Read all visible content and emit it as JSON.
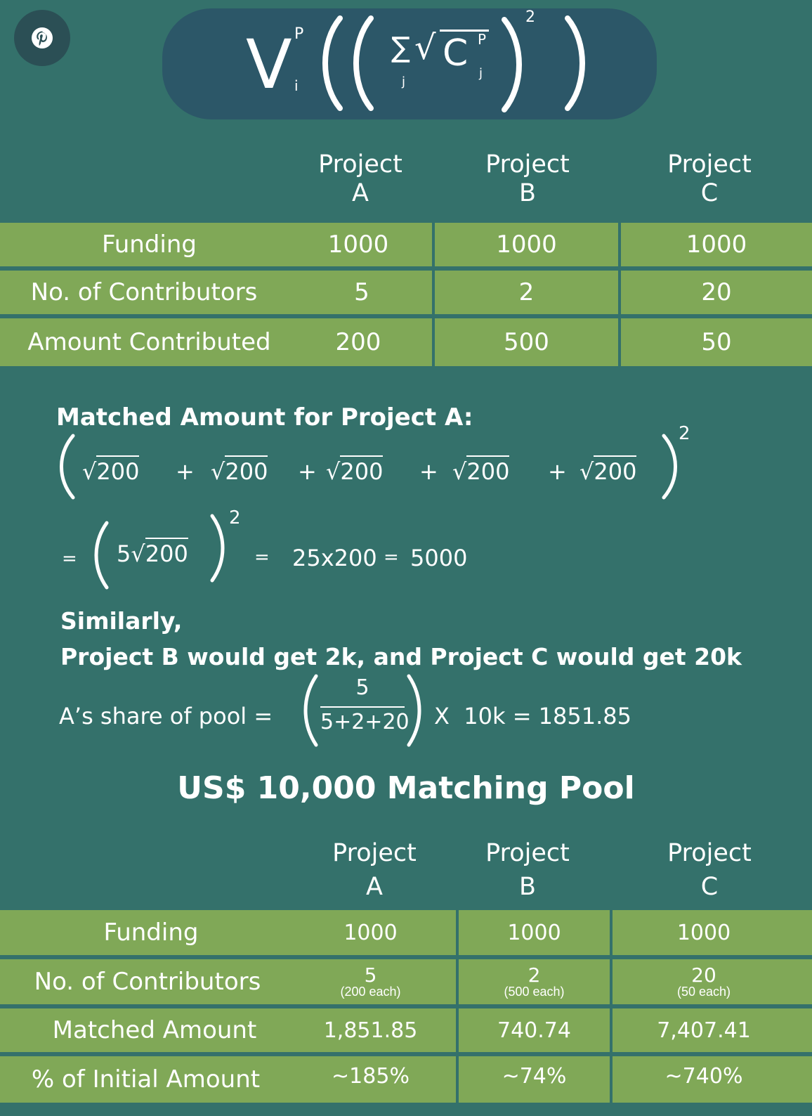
{
  "pin_icon": "pinterest-icon",
  "formula": {
    "v": "V",
    "sup_p": "P",
    "sub_i": "i",
    "sigma": "∑",
    "sub_j": "j",
    "sqrt": "√",
    "c": "C",
    "c_sup": "P",
    "c_sub": "j",
    "exp": "2"
  },
  "table1": {
    "headers": [
      {
        "line1": "Project",
        "line2": "A"
      },
      {
        "line1": "Project",
        "line2": "B"
      },
      {
        "line1": "Project",
        "line2": "C"
      }
    ],
    "rows": [
      {
        "label": "Funding",
        "values": [
          "1000",
          "1000",
          "1000"
        ]
      },
      {
        "label": "No. of Contributors",
        "values": [
          "5",
          "2",
          "20"
        ]
      },
      {
        "label": "Amount Contributed",
        "values": [
          "200",
          "500",
          "50"
        ]
      }
    ]
  },
  "math": {
    "heading": "Matched Amount for Project A:",
    "term": "200",
    "plus": "+",
    "exp": "2",
    "eq": "=",
    "five": "5",
    "calc": "25x200",
    "result": "5000",
    "similarly": "Similarly,",
    "summary": "Project B would get 2k, and Project C would get 20k",
    "share_label": "A’s share of pool =",
    "numerator": "5",
    "denominator": "5+2+20",
    "times": "X  10k = 1851.85"
  },
  "pool_title": "US$ 10,000 Matching Pool",
  "table2": {
    "headers": [
      {
        "line1": "Project",
        "line2": "A"
      },
      {
        "line1": "Project",
        "line2": "B"
      },
      {
        "line1": "Project",
        "line2": "C"
      }
    ],
    "funding_label": "Funding",
    "funding": [
      "1000",
      "1000",
      "1000"
    ],
    "contrib_label": "No. of Contributors",
    "contrib": [
      {
        "count": "5",
        "note": "(200 each)"
      },
      {
        "count": "2",
        "note": "(500 each)"
      },
      {
        "count": "20",
        "note": "(50 each)"
      }
    ],
    "matched_label": "Matched Amount",
    "matched": [
      "1,851.85",
      "740.74",
      "7,407.41"
    ],
    "pct_label": "% of Initial Amount",
    "pct": [
      "~185%",
      "~74%",
      "~740%"
    ]
  }
}
